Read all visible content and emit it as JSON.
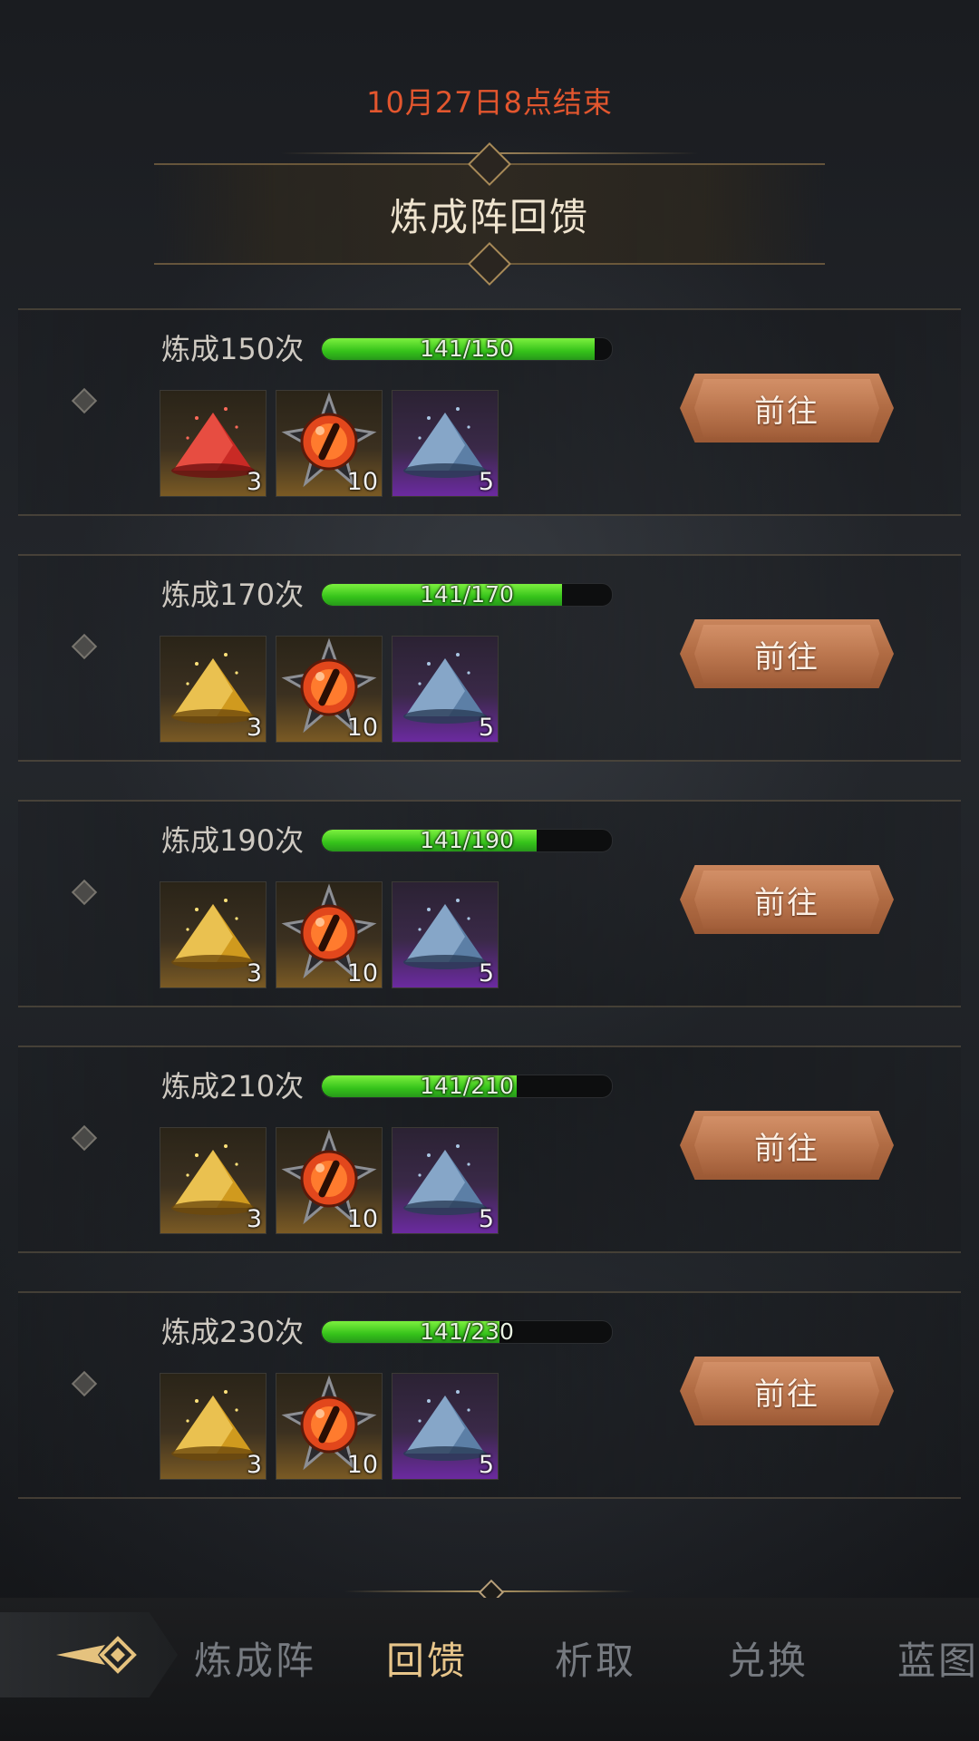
{
  "header": {
    "timer_text": "10月27日8点结束",
    "title": "炼成阵回馈"
  },
  "rewards": [
    {
      "label": "炼成150次",
      "progress_text": "141/150",
      "progress_fraction": 0.94,
      "items": [
        {
          "icon": "red-powder-icon",
          "count": "3",
          "rarity": "gold"
        },
        {
          "icon": "orange-eye-orb-icon",
          "count": "10",
          "rarity": "gold"
        },
        {
          "icon": "blue-powder-icon",
          "count": "5",
          "rarity": "purple"
        }
      ],
      "button_label": "前往"
    },
    {
      "label": "炼成170次",
      "progress_text": "141/170",
      "progress_fraction": 0.829,
      "items": [
        {
          "icon": "gold-powder-icon",
          "count": "3",
          "rarity": "gold"
        },
        {
          "icon": "orange-eye-orb-icon",
          "count": "10",
          "rarity": "gold"
        },
        {
          "icon": "blue-powder-icon",
          "count": "5",
          "rarity": "purple"
        }
      ],
      "button_label": "前往"
    },
    {
      "label": "炼成190次",
      "progress_text": "141/190",
      "progress_fraction": 0.742,
      "items": [
        {
          "icon": "gold-powder-icon",
          "count": "3",
          "rarity": "gold"
        },
        {
          "icon": "orange-eye-orb-icon",
          "count": "10",
          "rarity": "gold"
        },
        {
          "icon": "blue-powder-icon",
          "count": "5",
          "rarity": "purple"
        }
      ],
      "button_label": "前往"
    },
    {
      "label": "炼成210次",
      "progress_text": "141/210",
      "progress_fraction": 0.671,
      "items": [
        {
          "icon": "gold-powder-icon",
          "count": "3",
          "rarity": "gold"
        },
        {
          "icon": "orange-eye-orb-icon",
          "count": "10",
          "rarity": "gold"
        },
        {
          "icon": "blue-powder-icon",
          "count": "5",
          "rarity": "purple"
        }
      ],
      "button_label": "前往"
    },
    {
      "label": "炼成230次",
      "progress_text": "141/230",
      "progress_fraction": 0.613,
      "items": [
        {
          "icon": "gold-powder-icon",
          "count": "3",
          "rarity": "gold"
        },
        {
          "icon": "orange-eye-orb-icon",
          "count": "10",
          "rarity": "gold"
        },
        {
          "icon": "blue-powder-icon",
          "count": "5",
          "rarity": "purple"
        }
      ],
      "button_label": "前往"
    }
  ],
  "nav": {
    "back_icon": "arrow-back-icon",
    "tabs": [
      {
        "label": "炼成阵",
        "active": false
      },
      {
        "label": "回馈",
        "active": true
      },
      {
        "label": "析取",
        "active": false
      },
      {
        "label": "兑换",
        "active": false
      },
      {
        "label": "蓝图",
        "active": false
      }
    ]
  },
  "colors": {
    "timer": "#e3562e",
    "progress_green": "#46d420",
    "button_copper": "#b06b43",
    "active_tab": "#e7c58a",
    "inactive_tab": "#767a80"
  }
}
